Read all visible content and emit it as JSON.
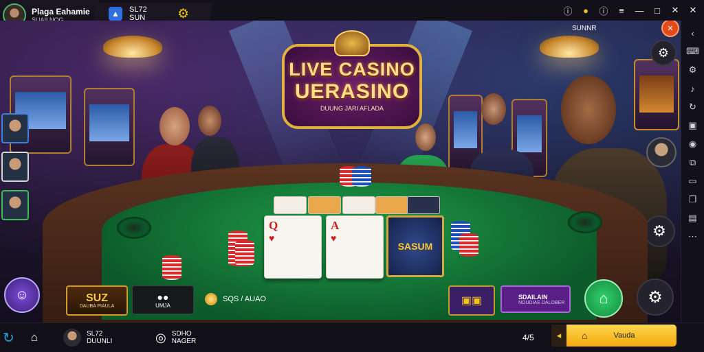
{
  "profile": {
    "name": "Plaga Eahamie",
    "subtitle": "SUAILNOG"
  },
  "player_card": {
    "line1": "SL72",
    "line2": "SUN"
  },
  "title_logo": {
    "line1": "LIVE CASINO",
    "line2": "UERASINO",
    "line3": "DUUNG JARI AFLADA"
  },
  "top_right_status": "SUNNR",
  "slot_card_label": "SASUM",
  "cards": [
    {
      "rank": "Q",
      "suit": "♥"
    },
    {
      "rank": "A",
      "suit": "♥"
    }
  ],
  "hud": {
    "bonus_big": "SUZ",
    "bonus_small": "DAUBA PIAULA",
    "sub_label": "UMJA",
    "balance": "SQS / AUAO",
    "promo_title": "SDAILAIN",
    "promo_sub": "NOUDIAE DALOBER"
  },
  "bottom": {
    "user_line1": "SL72",
    "user_line2": "DUUNLI",
    "chat_line1": "SDHO",
    "chat_line2": "NAGER",
    "ratio": "4/5",
    "action_label": "Vauda"
  },
  "icons": {
    "top_controls": [
      "info-icon",
      "location-icon",
      "alert-icon",
      "menu-icon",
      "minimize-icon",
      "maximize-icon",
      "close-icon"
    ],
    "sidebar": [
      "back-icon",
      "keyboard-icon",
      "gear-icon",
      "volume-icon",
      "rotate-icon",
      "screenshot-icon",
      "camera-icon",
      "layers-icon",
      "screen-icon",
      "copy-icon",
      "folder-icon",
      "more-icon"
    ]
  },
  "colors": {
    "felt": "#1f9d48",
    "accent_gold": "#f2c318",
    "green_button": "#30d16a"
  }
}
